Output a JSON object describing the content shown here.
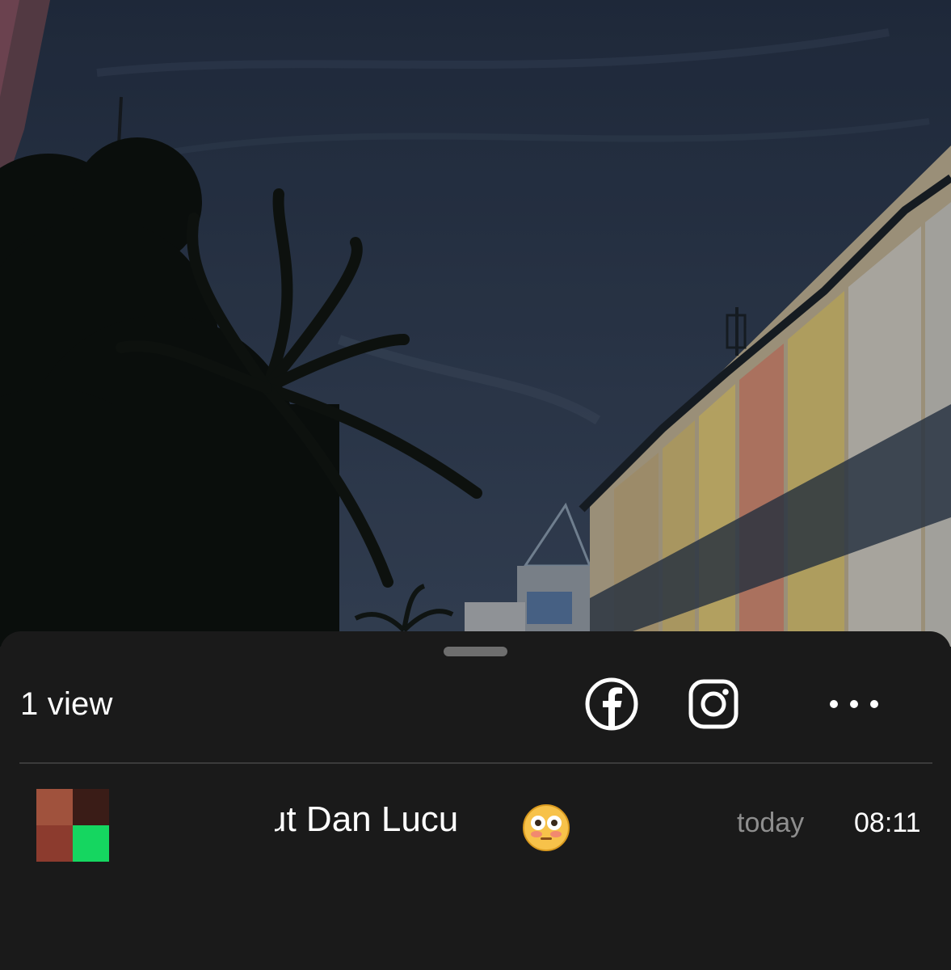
{
  "story": {
    "background_description_colors": {
      "sky_top": "#27344a",
      "sky_bottom": "#3e4d63",
      "foliage": "#0e1210",
      "building_accents": [
        "#d8c07a",
        "#d98a6a",
        "#c9b38d",
        "#e8d27a"
      ]
    }
  },
  "sheet": {
    "view_count": "1 view",
    "share_targets": [
      {
        "name": "facebook",
        "icon": "facebook-icon"
      },
      {
        "name": "instagram",
        "icon": "instagram-icon"
      },
      {
        "name": "more",
        "icon": "more-horizontal-icon"
      }
    ]
  },
  "viewers": [
    {
      "name_visible": "ut Dan Lucu",
      "emoji": "😳",
      "day": "today",
      "time": "08:11",
      "avatar_colors": [
        "#a0523d",
        "#3a1c17",
        "#8c3b2e",
        "#15d660"
      ]
    }
  ],
  "colors": {
    "sheet_bg": "#1a1a1a",
    "text_primary": "#ffffff",
    "text_secondary": "#8e8e8e",
    "divider": "#3b3b3b",
    "grabber": "#6e6e6e"
  }
}
